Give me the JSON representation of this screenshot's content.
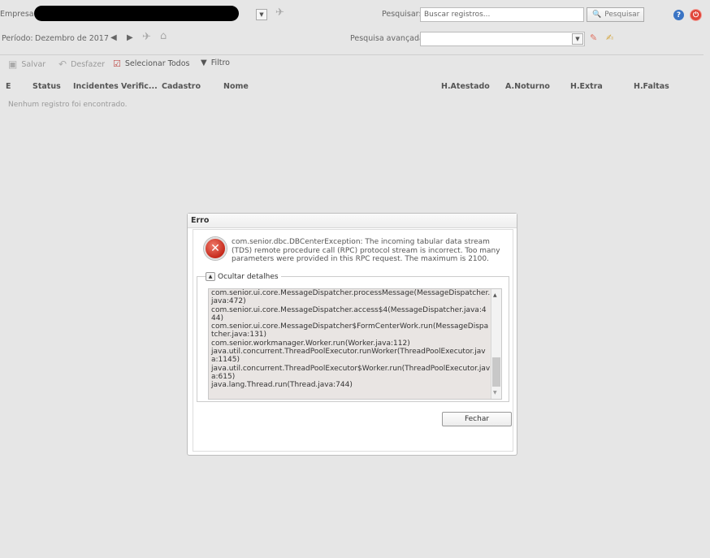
{
  "header": {
    "company_label": "Empresa:",
    "search_label": "Pesquisar:",
    "search_placeholder": "Buscar registros...",
    "search_button": "Pesquisar",
    "period_label": "Período:",
    "period_value": "Dezembro de 2017",
    "advanced_search_label": "Pesquisa avançada:"
  },
  "toolbar": {
    "save": "Salvar",
    "undo": "Desfazer",
    "select_all": "Selecionar Todos",
    "filter": "Filtro"
  },
  "table": {
    "columns": [
      "E",
      "Status",
      "Incidentes",
      "Verific...",
      "Cadastro",
      "Nome",
      "H.Atestado",
      "A.Noturno",
      "H.Extra",
      "H.Faltas"
    ],
    "empty_message": "Nenhum registro foi encontrado."
  },
  "dialog": {
    "title": "Erro",
    "message": "com.senior.dbc.DBCenterException: The incoming tabular data stream (TDS) remote procedure call (RPC) protocol stream is incorrect. Too many parameters were provided in this RPC request. The maximum is 2100.",
    "details_toggle": "Ocultar detalhes",
    "stack_trace": [
      "com.senior.ui.core.MessageDispatcher.processMessage(MessageDispatcher.java:472)",
      "com.senior.ui.core.MessageDispatcher.access$4(MessageDispatcher.java:444)",
      "com.senior.ui.core.MessageDispatcher$FormCenterWork.run(MessageDispatcher.java:131)",
      "com.senior.workmanager.Worker.run(Worker.java:112)",
      "java.util.concurrent.ThreadPoolExecutor.runWorker(ThreadPoolExecutor.java:1145)",
      "java.util.concurrent.ThreadPoolExecutor$Worker.run(ThreadPoolExecutor.java:615)",
      "java.lang.Thread.run(Thread.java:744)"
    ],
    "close_button": "Fechar"
  },
  "colors": {
    "background": "#e6e6e6",
    "error_red": "#c62a1c",
    "help_blue": "#3a74c4",
    "power_red": "#e0453a"
  }
}
